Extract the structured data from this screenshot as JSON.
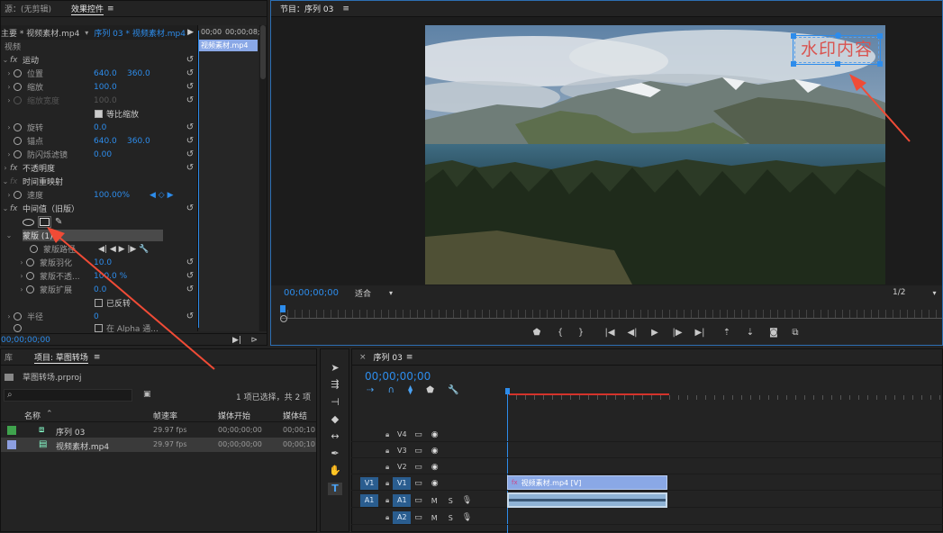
{
  "effect_controls": {
    "tab_source": "源：(无剪辑)",
    "tab_effects": "效果控件",
    "menu_icon": "≡",
    "master_label": "主要 * 视频素材.mp4",
    "sequence_label": "序列 03 * 视频素材.mp4",
    "time_start": "00;00",
    "time_end": "00;00;08;",
    "clip_name": "视频素材.mp4",
    "section_video": "视频",
    "motion": "运动",
    "position": "位置",
    "position_x": "640.0",
    "position_y": "360.0",
    "scale": "缩放",
    "scale_val": "100.0",
    "scale_width": "缩放宽度",
    "scale_width_val": "100.0",
    "uniform_scale": "等比缩放",
    "rotation": "旋转",
    "rotation_val": "0.0",
    "anchor": "锚点",
    "anchor_x": "640.0",
    "anchor_y": "360.0",
    "antiflicker": "防闪烁滤镜",
    "antiflicker_val": "0.00",
    "opacity": "不透明度",
    "time_remap": "时间重映射",
    "speed": "速度",
    "speed_val": "100.00%",
    "median": "中间值（旧版）",
    "mask": "蒙版 (1)",
    "mask_path": "蒙版路径",
    "mask_feather": "蒙版羽化",
    "mask_feather_val": "10.0",
    "mask_opacity": "蒙版不透...",
    "mask_opacity_val": "100.0 %",
    "mask_expand": "蒙版扩展",
    "mask_expand_val": "0.0",
    "inverted": "已反转",
    "radius": "半径",
    "radius_val": "0",
    "alpha": "在 Alpha 通...",
    "timecode": "00;00;00;00"
  },
  "program": {
    "title": "节目：序列 03",
    "menu_icon": "≡",
    "watermark": "水印内容",
    "timecode": "00;00;00;00",
    "fit": "适合",
    "resolution": "1/2"
  },
  "project": {
    "tab_library": "库",
    "tab_project": "项目: 草图转场",
    "menu_icon": "≡",
    "file": "草图转场.prproj",
    "selection": "1 项已选择，共 2 项",
    "columns": [
      "名称",
      "帧速率",
      "媒体开始",
      "媒体结"
    ],
    "items": [
      {
        "name": "序列 03",
        "fps": "29.97 fps",
        "start": "00;00;00;00",
        "end": "00;00;10",
        "color": "#3fa34d"
      },
      {
        "name": "视频素材.mp4",
        "fps": "29.97 fps",
        "start": "00;00;00;00",
        "end": "00;00;10",
        "color": "#8d9fe0"
      }
    ]
  },
  "timeline": {
    "title": "序列 03",
    "menu_icon": "≡",
    "timecode": "00;00;00;00",
    "tracks": [
      {
        "src": "",
        "name": "V4",
        "type": "video"
      },
      {
        "src": "",
        "name": "V3",
        "type": "video"
      },
      {
        "src": "",
        "name": "V2",
        "type": "video"
      },
      {
        "src": "V1",
        "name": "V1",
        "type": "video"
      },
      {
        "src": "A1",
        "name": "A1",
        "type": "audio"
      },
      {
        "src": "",
        "name": "A2",
        "type": "audio"
      }
    ],
    "video_clip": "视频素材.mp4 [V]",
    "m_label": "M",
    "s_label": "S"
  },
  "colors": {
    "accent": "#2d8ceb",
    "watermark_text": "#d9534f",
    "arrow": "#f04b36",
    "video_clip": "#8aa8e6",
    "audio_clip": "#8fb3d6",
    "work_area": "#d3332b"
  }
}
